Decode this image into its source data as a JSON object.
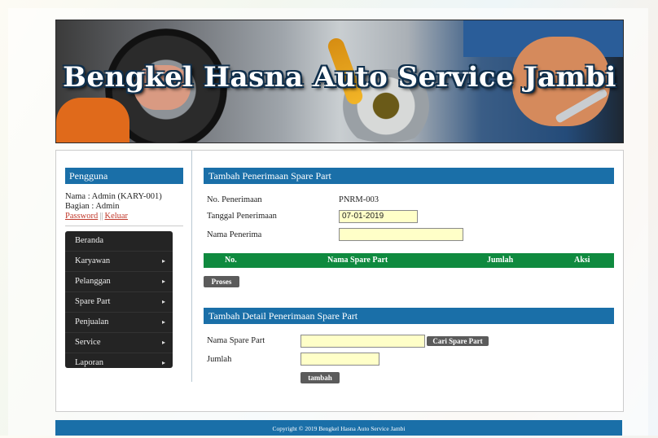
{
  "header": {
    "title": "Bengkel Hasna Auto Service Jambi"
  },
  "sidebar": {
    "heading": "Pengguna",
    "user_name": "Nama : Admin (KARY-001)",
    "user_role": "Bagian : Admin",
    "password_link": "Password",
    "separator": "||",
    "logout_link": "Keluar",
    "menu": [
      {
        "label": "Beranda"
      },
      {
        "label": "Karyawan"
      },
      {
        "label": "Pelanggan"
      },
      {
        "label": "Spare Part"
      },
      {
        "label": "Penjualan"
      },
      {
        "label": "Service"
      },
      {
        "label": "Laporan"
      }
    ],
    "chevron": "▸"
  },
  "form_penerimaan": {
    "title": "Tambah Penerimaan Spare Part",
    "no_label": "No. Penerimaan",
    "no_value": "PNRM-003",
    "tanggal_label": "Tanggal Penerimaan",
    "tanggal_value": "07-01-2019",
    "nama_label": "Nama Penerima",
    "nama_value": "",
    "table_headers": {
      "no": "No.",
      "nama": "Nama Spare Part",
      "jumlah": "Jumlah",
      "aksi": "Aksi"
    },
    "proses_button": "Proses"
  },
  "form_detail": {
    "title": "Tambah Detail Penerimaan Spare Part",
    "spare_label": "Nama Spare Part",
    "spare_value": "",
    "cari_button": "Cari Spare Part",
    "jumlah_label": "Jumlah",
    "jumlah_value": "",
    "tambah_button": "tambah"
  },
  "footer": {
    "text": "Copyright © 2019 Bengkel Hasna Auto Service Jambi"
  },
  "colors": {
    "primary": "#1a6fa8",
    "table_header": "#0f8a3f",
    "input_bg": "#ffffc8",
    "menu_bg": "#242424",
    "button": "#5b5b5b",
    "link": "#c0392b"
  }
}
